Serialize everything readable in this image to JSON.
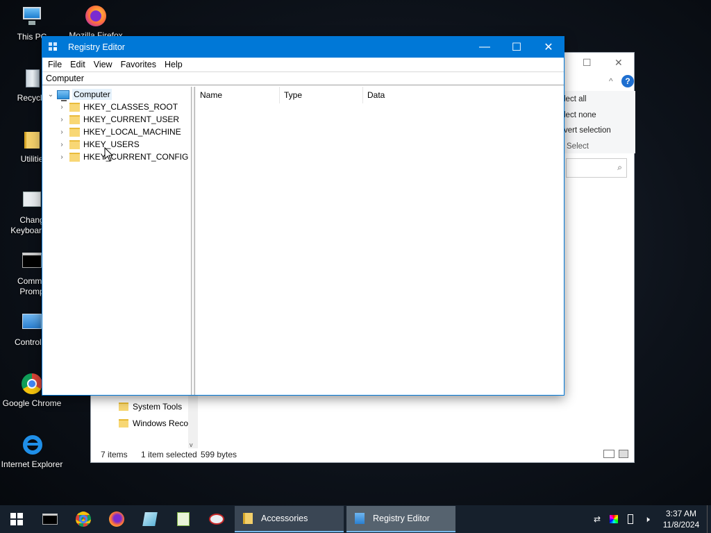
{
  "desktop": {
    "icons": [
      {
        "label": "This PC"
      },
      {
        "label": "Mozilla Firefox"
      },
      {
        "label": "Recycle"
      },
      {
        "label": "Utilitie"
      },
      {
        "label": "Chang",
        "label2": "Keyboard L"
      },
      {
        "label": "Comma",
        "label2": "Promp"
      },
      {
        "label": "Control P"
      },
      {
        "label": "Google Chrome"
      },
      {
        "label": "Internet Explorer"
      }
    ]
  },
  "explorer": {
    "ribbon": [
      "lect all",
      "lect none",
      "vert selection",
      "Select"
    ],
    "folders": [
      "System Tools",
      "Windows Reco"
    ],
    "status": {
      "items": "7 items",
      "selected": "1 item selected",
      "size": "599 bytes"
    }
  },
  "regedit": {
    "title": "Registry Editor",
    "menu": [
      "File",
      "Edit",
      "View",
      "Favorites",
      "Help"
    ],
    "address": "Computer",
    "tree": {
      "root": "Computer",
      "children": [
        "HKEY_CLASSES_ROOT",
        "HKEY_CURRENT_USER",
        "HKEY_LOCAL_MACHINE",
        "HKEY_USERS",
        "HKEY_CURRENT_CONFIG"
      ]
    },
    "columns": [
      "Name",
      "Type",
      "Data"
    ],
    "controls": {
      "minimize": "—",
      "maximize": "☐",
      "close": "✕"
    }
  },
  "taskbar": {
    "buttons": [
      "Accessories",
      "Registry Editor"
    ],
    "clock": {
      "time": "3:37 AM",
      "date": "11/8/2024"
    }
  },
  "colors": {
    "titlebar": "#0078d7",
    "taskbar": "#16202c",
    "folder": "#f8d775"
  }
}
